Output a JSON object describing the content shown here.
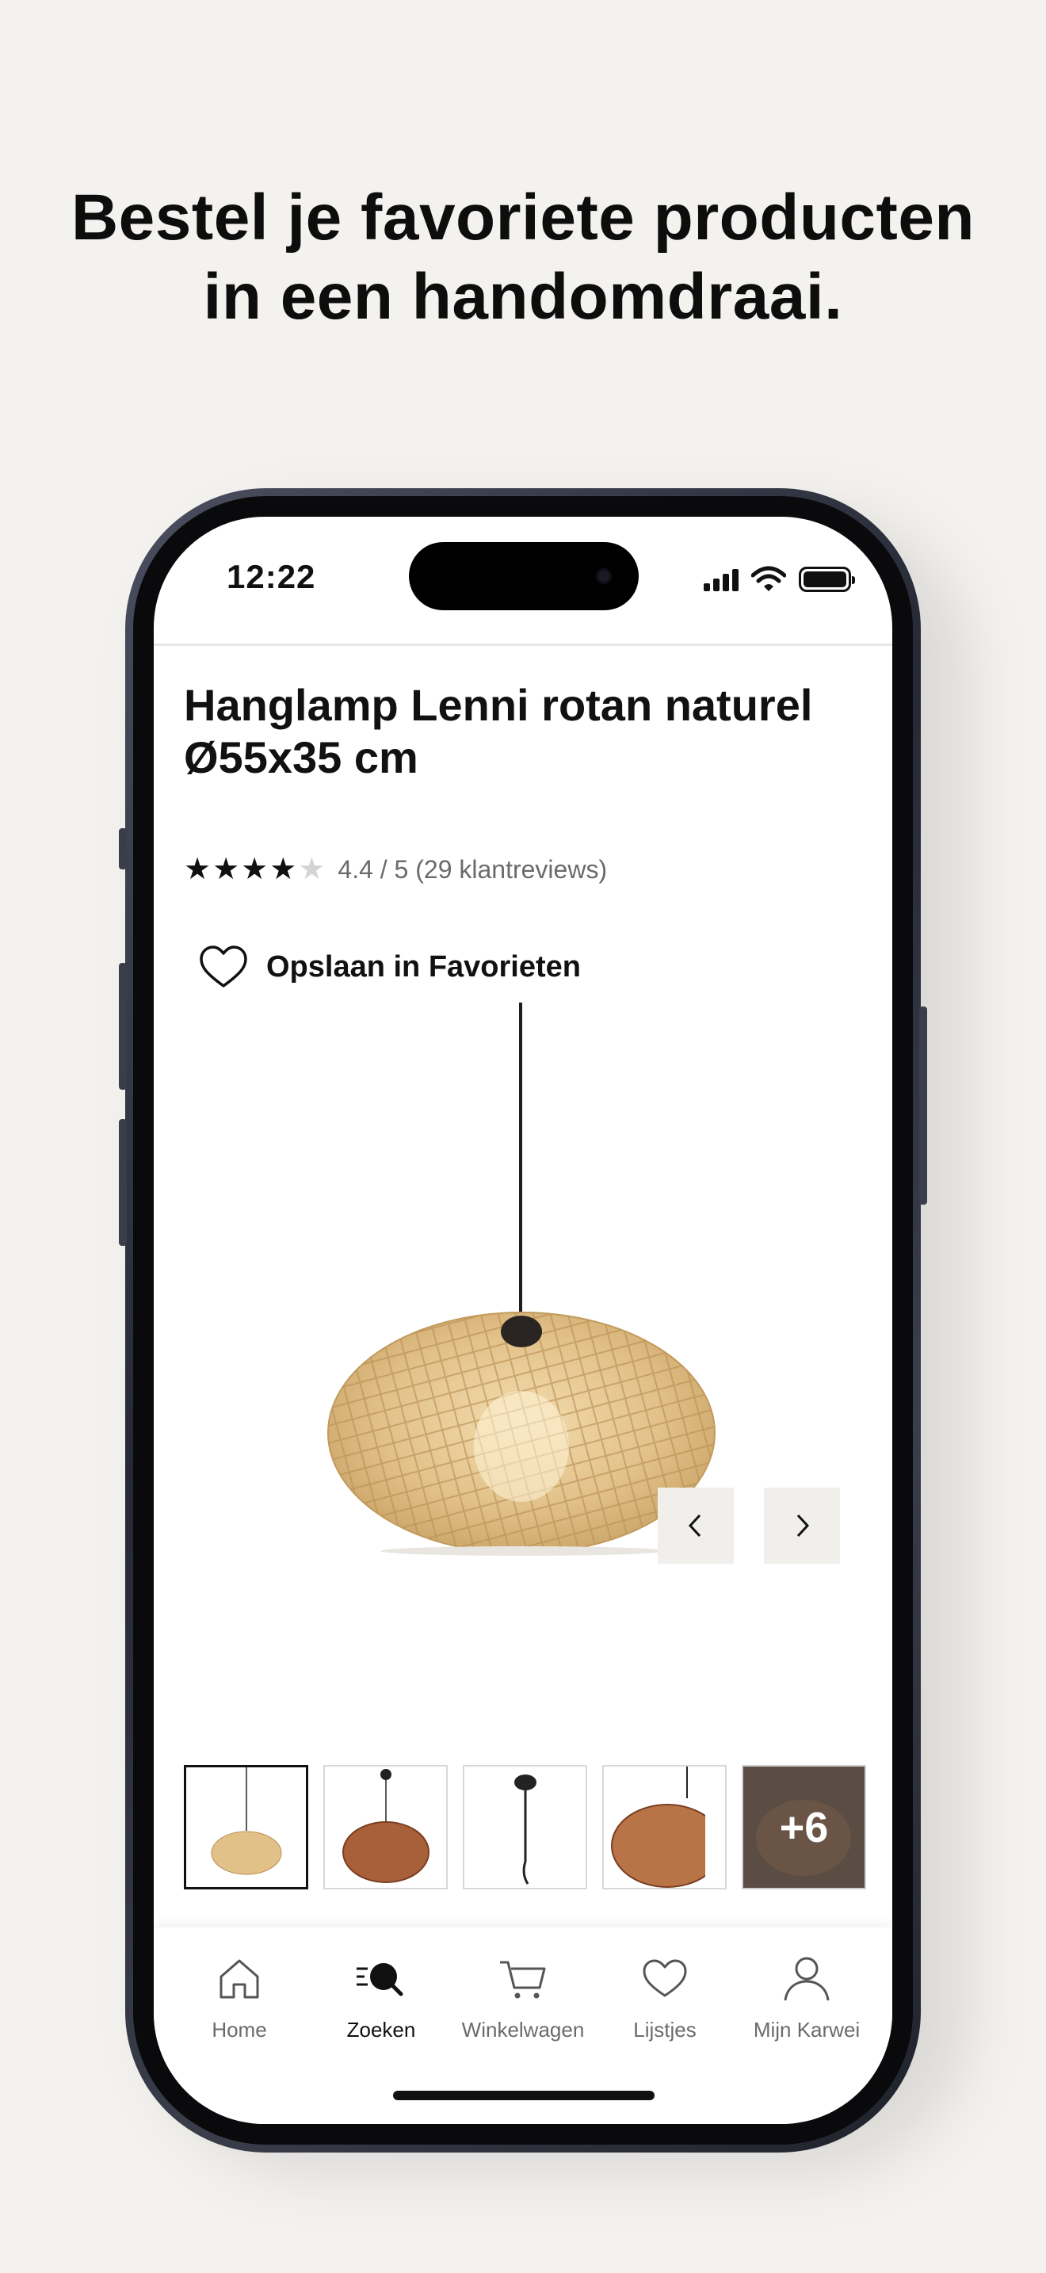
{
  "headline": {
    "line1": "Bestel je favoriete producten",
    "line2": "in een handomdraai."
  },
  "status_bar": {
    "time": "12:22",
    "icons": [
      "signal-icon",
      "wifi-icon",
      "battery-icon"
    ]
  },
  "product": {
    "title_line1": "Hanglamp Lenni rotan naturel",
    "title_line2": "Ø55x35 cm",
    "rating_value": 4.4,
    "rating_max": 5,
    "rating_text": "4.4 / 5 (29 klantreviews)",
    "favorite_label": "Opslaan in Favorieten",
    "image_icon": "pendant-lamp-image"
  },
  "gallery": {
    "prev_icon": "chevron-left-icon",
    "next_icon": "chevron-right-icon",
    "thumbnails": [
      "natural-rattan-lamp",
      "brown-rattan-lamp",
      "black-cord-detail",
      "rattan-close-up",
      "more-images"
    ],
    "more_label": "+6"
  },
  "tabbar": {
    "items": [
      {
        "label": "Home",
        "icon": "home-icon",
        "active": false
      },
      {
        "label": "Zoeken",
        "icon": "search-icon",
        "active": true
      },
      {
        "label": "Winkelwagen",
        "icon": "cart-icon",
        "active": false
      },
      {
        "label": "Lijstjes",
        "icon": "heart-icon",
        "active": false
      },
      {
        "label": "Mijn Karwei",
        "icon": "profile-icon",
        "active": false
      }
    ]
  },
  "colors": {
    "background": "#f4f2ef",
    "text": "#111111",
    "muted": "#6a6a6a",
    "rattan": "#d9b47a",
    "phone_frame": "#2b2e3a"
  }
}
